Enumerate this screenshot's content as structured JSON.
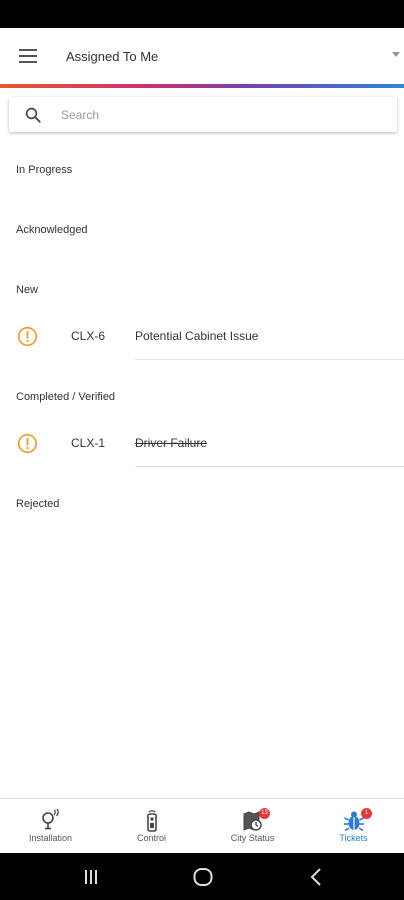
{
  "app_bar": {
    "filter_label": "Assigned To Me"
  },
  "search": {
    "placeholder": "Search",
    "value": ""
  },
  "sections": [
    {
      "header": "In Progress"
    },
    {
      "header": "Acknowledged"
    },
    {
      "header": "New"
    },
    {
      "header": "Completed / Verified"
    },
    {
      "header": "Rejected"
    }
  ],
  "tickets": [
    {
      "id": "CLX-6",
      "title": "Potential Cabinet Issue",
      "icon": "warning-circle-icon",
      "struck": false
    },
    {
      "id": "CLX-1",
      "title": "Driver Failure",
      "icon": "warning-circle-icon",
      "struck": true
    }
  ],
  "bottom_nav": {
    "installation_label": "Installation",
    "control_label": "Control",
    "city_status_label": "City Status",
    "city_status_badge": "13",
    "tickets_label": "Tickets",
    "tickets_badge": "1"
  },
  "colors": {
    "accent_gradient": [
      "#e8582e",
      "#d0326e",
      "#7a3fa8",
      "#2e86d6"
    ],
    "warning": "#f0a030",
    "active_tab": "#2d7bd8",
    "badge": "#e53935"
  }
}
